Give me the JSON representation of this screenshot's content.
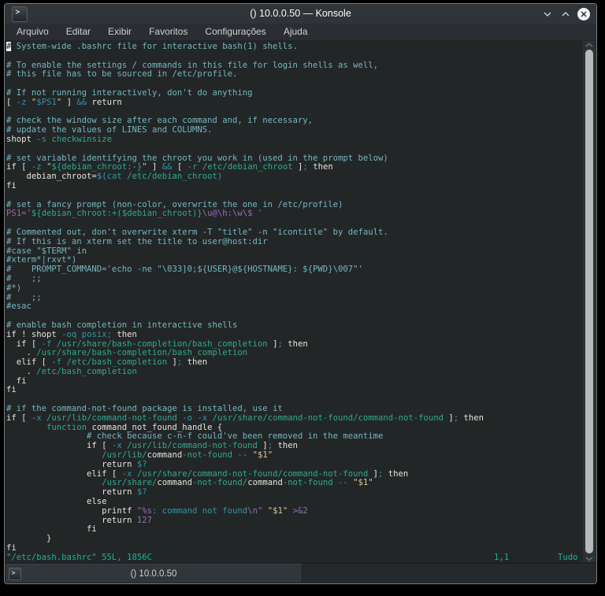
{
  "window": {
    "title": "() 10.0.0.50 — Konsole",
    "app_icon": "konsole-terminal-icon",
    "controls": {
      "minimize": "chevron-down",
      "maximize": "chevron-up",
      "close": "circle-x"
    }
  },
  "menu": {
    "items": [
      "Arquivo",
      "Editar",
      "Exibir",
      "Favoritos",
      "Configurações",
      "Ajuda"
    ]
  },
  "colors": {
    "page_bg": "#000000",
    "titlebar_bg": "#2f3438",
    "menubar_bg": "#2a2e32",
    "terminal_bg": "#232627",
    "tab_active_bg": "#31363b",
    "normal": "#e6e4da",
    "comment": "#74b6c0",
    "green": "#2eaa8c",
    "teal": "#2f95a6",
    "blue": "#4a8cc9",
    "purple": "#9a6bb8",
    "magenta": "#aa5f9e",
    "cream": "#d6c795",
    "status": "#19b495",
    "cursor_bg": "#fcfcfc"
  },
  "terminal": {
    "lines": [
      [
        {
          "t": "#",
          "c": "cursor"
        },
        {
          "t": " System-wide .bashrc file for interactive bash(1) shells.",
          "c": "comment"
        }
      ],
      [],
      [
        {
          "t": "# To enable the settings / commands in this file for login shells as well,",
          "c": "comment"
        }
      ],
      [
        {
          "t": "# this file has to be sourced in /etc/profile.",
          "c": "comment"
        }
      ],
      [],
      [
        {
          "t": "# If not running interactively, don't do anything",
          "c": "comment"
        }
      ],
      [
        {
          "t": "[ ",
          "c": "normal"
        },
        {
          "t": "-z",
          "c": "teal"
        },
        {
          "t": " ",
          "c": "normal"
        },
        {
          "t": "\"",
          "c": "cream"
        },
        {
          "t": "$PS1",
          "c": "teal"
        },
        {
          "t": "\"",
          "c": "cream"
        },
        {
          "t": " ] ",
          "c": "normal"
        },
        {
          "t": "&&",
          "c": "teal"
        },
        {
          "t": " return",
          "c": "normal"
        }
      ],
      [],
      [
        {
          "t": "# check the window size after each command and, if necessary,",
          "c": "comment"
        }
      ],
      [
        {
          "t": "# update the values of LINES and COLUMNS.",
          "c": "comment"
        }
      ],
      [
        {
          "t": "shopt ",
          "c": "normal"
        },
        {
          "t": "-s",
          "c": "teal"
        },
        {
          "t": " ",
          "c": "normal"
        },
        {
          "t": "checkwinsize",
          "c": "green"
        }
      ],
      [],
      [
        {
          "t": "# set variable identifying the chroot you work in (used in the prompt below)",
          "c": "comment"
        }
      ],
      [
        {
          "t": "if [ ",
          "c": "normal"
        },
        {
          "t": "-z",
          "c": "teal"
        },
        {
          "t": " ",
          "c": "normal"
        },
        {
          "t": "\"",
          "c": "cream"
        },
        {
          "t": "${debian_chroot:-}",
          "c": "green"
        },
        {
          "t": "\"",
          "c": "cream"
        },
        {
          "t": " ] ",
          "c": "normal"
        },
        {
          "t": "&&",
          "c": "teal"
        },
        {
          "t": " [ ",
          "c": "normal"
        },
        {
          "t": "-r",
          "c": "teal"
        },
        {
          "t": " ",
          "c": "normal"
        },
        {
          "t": "/etc/debian_chroot",
          "c": "green"
        },
        {
          "t": " ]",
          "c": "normal"
        },
        {
          "t": ";",
          "c": "teal"
        },
        {
          "t": " then",
          "c": "normal"
        }
      ],
      [
        {
          "t": "    debian_chroot=",
          "c": "normal"
        },
        {
          "t": "$(",
          "c": "blue"
        },
        {
          "t": "cat ",
          "c": "teal"
        },
        {
          "t": "/etc/debian_chroot",
          "c": "green"
        },
        {
          "t": ")",
          "c": "blue"
        }
      ],
      [
        {
          "t": "fi",
          "c": "normal"
        }
      ],
      [],
      [
        {
          "t": "# set a fancy prompt (non-color, overwrite the one in /etc/profile)",
          "c": "comment"
        }
      ],
      [
        {
          "t": "PS1='",
          "c": "magenta"
        },
        {
          "t": "${debian_chroot:+($debian_chroot)}",
          "c": "green"
        },
        {
          "t": "\\u@\\h:\\w\\$",
          "c": "purple"
        },
        {
          "t": " '",
          "c": "magenta"
        }
      ],
      [],
      [
        {
          "t": "# Commented out, don't overwrite xterm -T \"title\" -n \"icontitle\" by default.",
          "c": "comment"
        }
      ],
      [
        {
          "t": "# If this is an xterm set the title to user@host:dir",
          "c": "comment"
        }
      ],
      [
        {
          "t": "#case \"$TERM\" in",
          "c": "comment"
        }
      ],
      [
        {
          "t": "#xterm*|rxvt*)",
          "c": "comment"
        }
      ],
      [
        {
          "t": "#    PROMPT_COMMAND='echo -ne \"\\033]0;${USER}@${HOSTNAME}: ${PWD}\\007\"'",
          "c": "comment"
        }
      ],
      [
        {
          "t": "#    ;;",
          "c": "comment"
        }
      ],
      [
        {
          "t": "#*)",
          "c": "comment"
        }
      ],
      [
        {
          "t": "#    ;;",
          "c": "comment"
        }
      ],
      [
        {
          "t": "#esac",
          "c": "comment"
        }
      ],
      [],
      [
        {
          "t": "# enable bash completion in interactive shells",
          "c": "comment"
        }
      ],
      [
        {
          "t": "if ! shopt ",
          "c": "normal"
        },
        {
          "t": "-oq",
          "c": "teal"
        },
        {
          "t": " ",
          "c": "normal"
        },
        {
          "t": "posix",
          "c": "teal"
        },
        {
          "t": ";",
          "c": "teal"
        },
        {
          "t": " then",
          "c": "normal"
        }
      ],
      [
        {
          "t": "  if [ ",
          "c": "normal"
        },
        {
          "t": "-f",
          "c": "teal"
        },
        {
          "t": " ",
          "c": "normal"
        },
        {
          "t": "/usr/share/bash-completion/bash_completion",
          "c": "green"
        },
        {
          "t": " ]",
          "c": "normal"
        },
        {
          "t": ";",
          "c": "teal"
        },
        {
          "t": " then",
          "c": "normal"
        }
      ],
      [
        {
          "t": "    . ",
          "c": "normal"
        },
        {
          "t": "/usr/share/bash-completion/bash_completion",
          "c": "green"
        }
      ],
      [
        {
          "t": "  elif [ ",
          "c": "normal"
        },
        {
          "t": "-f",
          "c": "teal"
        },
        {
          "t": " ",
          "c": "normal"
        },
        {
          "t": "/etc/bash_completion",
          "c": "green"
        },
        {
          "t": " ]",
          "c": "normal"
        },
        {
          "t": ";",
          "c": "teal"
        },
        {
          "t": " then",
          "c": "normal"
        }
      ],
      [
        {
          "t": "    . ",
          "c": "normal"
        },
        {
          "t": "/etc/bash_completion",
          "c": "green"
        }
      ],
      [
        {
          "t": "  fi",
          "c": "normal"
        }
      ],
      [
        {
          "t": "fi",
          "c": "normal"
        }
      ],
      [],
      [
        {
          "t": "# if the command-not-found package is installed, use it",
          "c": "comment"
        }
      ],
      [
        {
          "t": "if [ ",
          "c": "normal"
        },
        {
          "t": "-x",
          "c": "teal"
        },
        {
          "t": " ",
          "c": "normal"
        },
        {
          "t": "/usr/lib/command-not-found",
          "c": "green"
        },
        {
          "t": " ",
          "c": "normal"
        },
        {
          "t": "-o",
          "c": "teal"
        },
        {
          "t": " ",
          "c": "normal"
        },
        {
          "t": "-x",
          "c": "teal"
        },
        {
          "t": " ",
          "c": "normal"
        },
        {
          "t": "/usr/share/command-not-found/command-not-found",
          "c": "green"
        },
        {
          "t": " ]",
          "c": "normal"
        },
        {
          "t": ";",
          "c": "teal"
        },
        {
          "t": " then",
          "c": "normal"
        }
      ],
      [
        {
          "t": "        ",
          "c": "normal"
        },
        {
          "t": "function",
          "c": "green"
        },
        {
          "t": " command_not_found_handle {",
          "c": "normal"
        }
      ],
      [
        {
          "t": "                # check because c-n-f could've been removed in the meantime",
          "c": "comment"
        }
      ],
      [
        {
          "t": "                if [ ",
          "c": "normal"
        },
        {
          "t": "-x",
          "c": "teal"
        },
        {
          "t": " ",
          "c": "normal"
        },
        {
          "t": "/usr/lib/command-not-found",
          "c": "green"
        },
        {
          "t": " ]",
          "c": "normal"
        },
        {
          "t": ";",
          "c": "teal"
        },
        {
          "t": " then",
          "c": "normal"
        }
      ],
      [
        {
          "t": "                   ",
          "c": "normal"
        },
        {
          "t": "/usr/lib/",
          "c": "green"
        },
        {
          "t": "command",
          "c": "normal"
        },
        {
          "t": "-not-found",
          "c": "green"
        },
        {
          "t": " ",
          "c": "normal"
        },
        {
          "t": "--",
          "c": "teal"
        },
        {
          "t": " ",
          "c": "normal"
        },
        {
          "t": "\"$1\"",
          "c": "cream"
        }
      ],
      [
        {
          "t": "                   return ",
          "c": "normal"
        },
        {
          "t": "$?",
          "c": "teal"
        }
      ],
      [
        {
          "t": "                elif [ ",
          "c": "normal"
        },
        {
          "t": "-x",
          "c": "teal"
        },
        {
          "t": " ",
          "c": "normal"
        },
        {
          "t": "/usr/share/command-not-found/command-not-found",
          "c": "green"
        },
        {
          "t": " ]",
          "c": "normal"
        },
        {
          "t": ";",
          "c": "teal"
        },
        {
          "t": " then",
          "c": "normal"
        }
      ],
      [
        {
          "t": "                   ",
          "c": "normal"
        },
        {
          "t": "/usr/share/",
          "c": "green"
        },
        {
          "t": "command",
          "c": "normal"
        },
        {
          "t": "-not-found/",
          "c": "green"
        },
        {
          "t": "command",
          "c": "normal"
        },
        {
          "t": "-not-found",
          "c": "green"
        },
        {
          "t": " ",
          "c": "normal"
        },
        {
          "t": "--",
          "c": "teal"
        },
        {
          "t": " ",
          "c": "normal"
        },
        {
          "t": "\"$1\"",
          "c": "cream"
        }
      ],
      [
        {
          "t": "                   return ",
          "c": "normal"
        },
        {
          "t": "$?",
          "c": "teal"
        }
      ],
      [
        {
          "t": "                else",
          "c": "normal"
        }
      ],
      [
        {
          "t": "                   printf ",
          "c": "normal"
        },
        {
          "t": "\"",
          "c": "magenta"
        },
        {
          "t": "%s",
          "c": "purple"
        },
        {
          "t": ": command not found",
          "c": "teal"
        },
        {
          "t": "\\n",
          "c": "purple"
        },
        {
          "t": "\"",
          "c": "magenta"
        },
        {
          "t": " ",
          "c": "normal"
        },
        {
          "t": "\"$1\"",
          "c": "cream"
        },
        {
          "t": " ",
          "c": "normal"
        },
        {
          "t": ">&2",
          "c": "purple"
        }
      ],
      [
        {
          "t": "                   return ",
          "c": "normal"
        },
        {
          "t": "127",
          "c": "purple"
        }
      ],
      [
        {
          "t": "                fi",
          "c": "normal"
        }
      ],
      [
        {
          "t": "        }",
          "c": "normal"
        }
      ],
      [
        {
          "t": "fi",
          "c": "normal"
        }
      ]
    ],
    "status_line": {
      "left": "\"/etc/bash.bashrc\" 55L, 1856C",
      "ruler": "1,1",
      "scroll_position": "Tudo"
    }
  },
  "tabbar": {
    "tabs": [
      {
        "label": "() 10.0.0.50",
        "active": true,
        "icon": "terminal-icon"
      }
    ]
  }
}
